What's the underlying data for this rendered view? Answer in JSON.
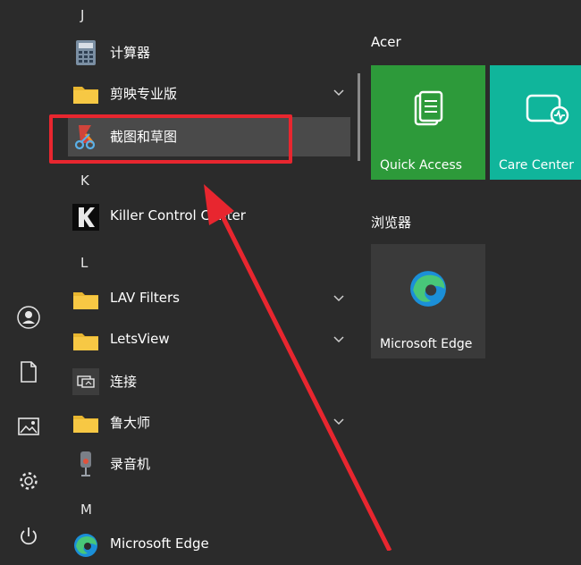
{
  "left_rail": {
    "items": [
      {
        "icon": "user-icon"
      },
      {
        "icon": "document-icon"
      },
      {
        "icon": "pictures-icon"
      },
      {
        "icon": "gear-icon"
      },
      {
        "icon": "power-icon"
      }
    ]
  },
  "app_list": {
    "letter_j": "J",
    "letter_k": "K",
    "letter_l": "L",
    "letter_m": "M",
    "items": [
      {
        "label": "计算器",
        "icon": "calculator-icon"
      },
      {
        "label": "剪映专业版",
        "icon": "folder-icon",
        "expandable": true
      },
      {
        "label": "截图和草图",
        "icon": "snip-sketch-icon",
        "selected": true
      },
      {
        "label": "Killer Control Center",
        "icon": "killer-icon"
      },
      {
        "label": "LAV Filters",
        "icon": "folder-icon",
        "expandable": true
      },
      {
        "label": "LetsView",
        "icon": "folder-icon",
        "expandable": true
      },
      {
        "label": "连接",
        "icon": "connect-icon"
      },
      {
        "label": "鲁大师",
        "icon": "folder-icon",
        "expandable": true
      },
      {
        "label": "录音机",
        "icon": "voice-recorder-icon"
      },
      {
        "label": "Microsoft Edge",
        "icon": "edge-icon"
      }
    ]
  },
  "tiles": {
    "group_acer": "Acer",
    "group_browser": "浏览器",
    "items": [
      {
        "label": "Quick Access",
        "color": "#2d9a3a",
        "icon": "quick-access-icon"
      },
      {
        "label": "Care Center",
        "color": "#10b59b",
        "icon": "care-center-icon"
      },
      {
        "label": "Microsoft Edge",
        "color": "#3a3a3a",
        "icon": "edge-icon"
      }
    ]
  },
  "annotation": {
    "box_color": "#e8262f",
    "arrow_color": "#e8262f"
  }
}
